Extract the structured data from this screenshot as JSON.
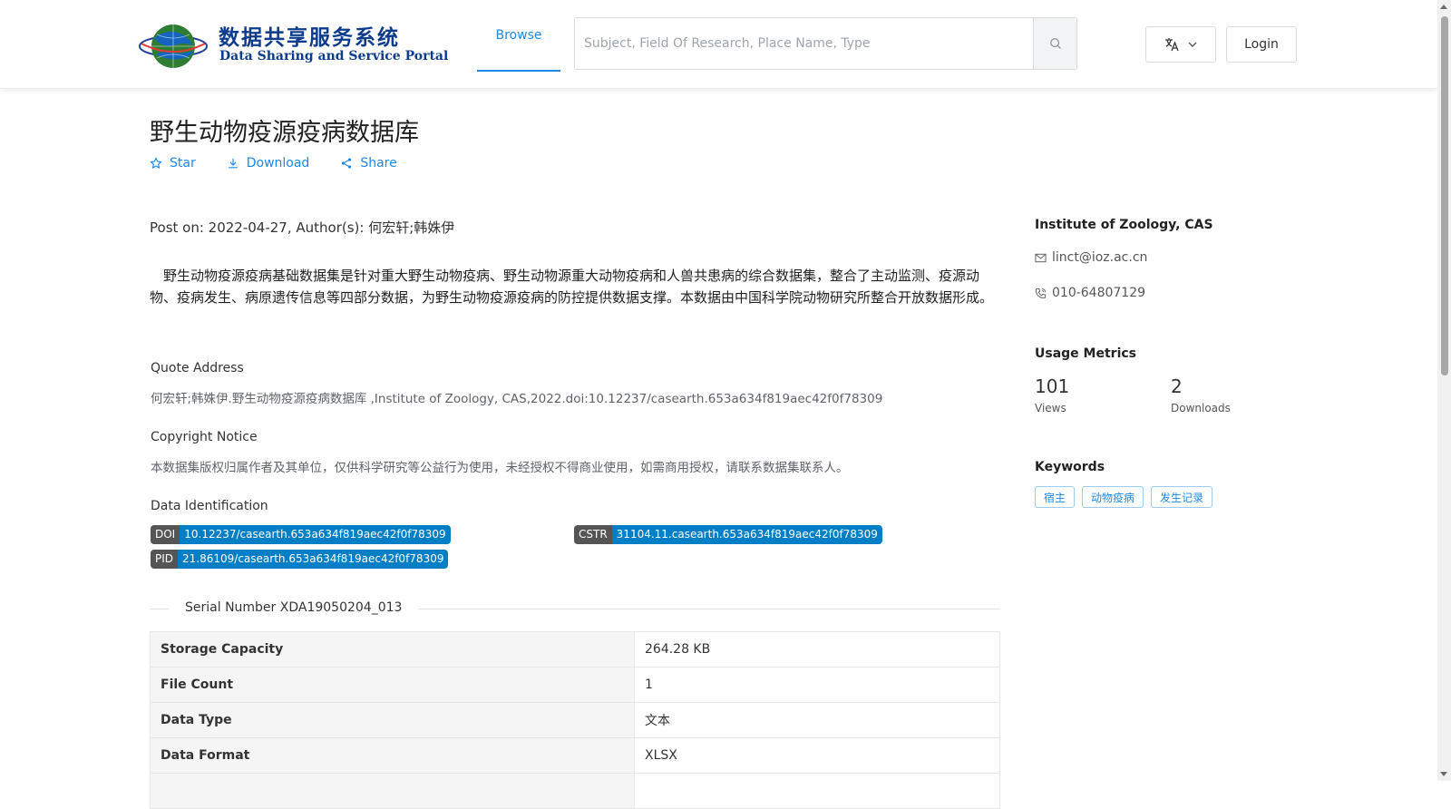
{
  "header": {
    "logo_cn": "数据共享服务系统",
    "logo_en": "Data Sharing and Service Portal",
    "nav_browse": "Browse",
    "search_placeholder": "Subject, Field Of Research, Place Name, Type",
    "login": "Login"
  },
  "dataset": {
    "title": "野生动物疫源疫病数据库",
    "actions": {
      "star": "Star",
      "download": "Download",
      "share": "Share"
    },
    "post_line": "Post on: 2022-04-27, Author(s): 何宏轩;韩姝伊",
    "abstract": "　野生动物疫源疫病基础数据集是针对重大野生动物疫病、野生动物源重大动物疫病和人兽共患病的综合数据集，整合了主动监测、疫源动物、疫病发生、病原遗传信息等四部分数据，为野生动物疫源疫病的防控提供数据支撑。本数据由中国科学院动物研究所整合开放数据形成。",
    "quote_label": "Quote Address",
    "quote_text": "何宏轩;韩姝伊.野生动物疫源疫病数据库 ,Institute of Zoology, CAS,2022.doi:10.12237/casearth.653a634f819aec42f0f78309",
    "copyright_label": "Copyright Notice",
    "copyright_text": "本数据集版权归属作者及其单位，仅供科学研究等公益行为使用，未经授权不得商业使用，如需商用授权，请联系数据集联系人。",
    "identification_label": "Data Identification",
    "identifiers": {
      "doi": {
        "key": "DOI",
        "value": "10.12237/casearth.653a634f819aec42f0f78309"
      },
      "cstr": {
        "key": "CSTR",
        "value": "31104.11.casearth.653a634f819aec42f0f78309"
      },
      "pid": {
        "key": "PID",
        "value": "21.86109/casearth.653a634f819aec42f0f78309"
      }
    },
    "serial_number": "Serial Number XDA19050204_013",
    "info_rows": [
      {
        "key": "Storage Capacity",
        "value": "264.28 KB"
      },
      {
        "key": "File Count",
        "value": "1"
      },
      {
        "key": "Data Type",
        "value": "文本"
      },
      {
        "key": "Data Format",
        "value": "XLSX"
      }
    ]
  },
  "sidebar": {
    "institution": "Institute of Zoology, CAS",
    "email": "linct@ioz.ac.cn",
    "phone": "010-64807129",
    "metrics_title": "Usage Metrics",
    "views_value": "101",
    "views_label": "Views",
    "downloads_value": "2",
    "downloads_label": "Downloads",
    "keywords_title": "Keywords",
    "keywords": [
      "宿主",
      "动物疫病",
      "发生记录"
    ]
  },
  "colors": {
    "accent": "#1e88e5",
    "badge_key": "#555555",
    "badge_value": "#007ec6"
  }
}
